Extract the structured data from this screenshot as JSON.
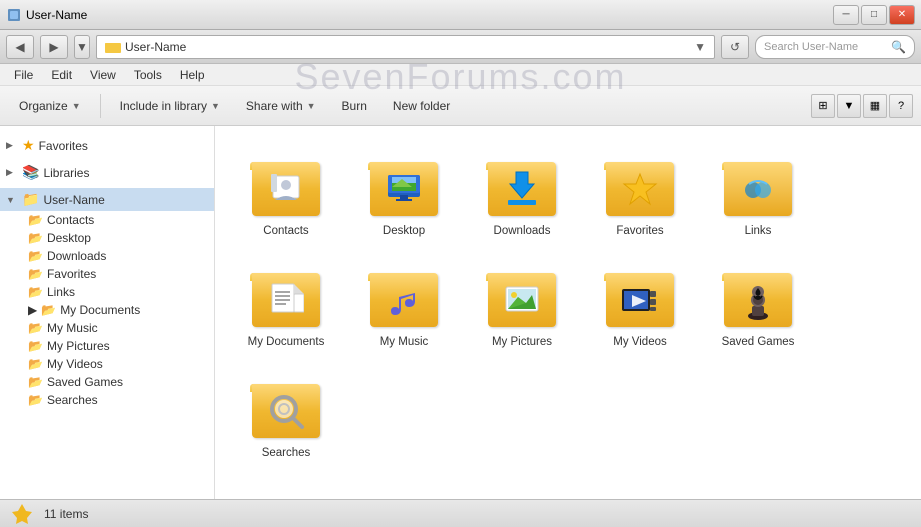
{
  "titlebar": {
    "title": "User-Name",
    "controls": {
      "minimize": "─",
      "maximize": "□",
      "close": "✕"
    }
  },
  "addressbar": {
    "back": "◀",
    "forward": "▶",
    "path": "User-Name",
    "search_placeholder": "Search User-Name"
  },
  "menubar": {
    "items": [
      "File",
      "Edit",
      "View",
      "Tools",
      "Help"
    ]
  },
  "toolbar": {
    "organize": "Organize",
    "include_library": "Include in library",
    "share_with": "Share with",
    "burn": "Burn",
    "new_folder": "New folder",
    "help": "?"
  },
  "sidebar": {
    "favorites_label": "Favorites",
    "libraries_label": "Libraries",
    "username_label": "User-Name",
    "items": [
      {
        "label": "Contacts",
        "selected": false
      },
      {
        "label": "Desktop",
        "selected": false
      },
      {
        "label": "Downloads",
        "selected": false
      },
      {
        "label": "Favorites",
        "selected": false
      },
      {
        "label": "Links",
        "selected": false
      },
      {
        "label": "My Documents",
        "selected": false
      },
      {
        "label": "My Music",
        "selected": false
      },
      {
        "label": "My Pictures",
        "selected": false
      },
      {
        "label": "My Videos",
        "selected": false
      },
      {
        "label": "Saved Games",
        "selected": false
      },
      {
        "label": "Searches",
        "selected": false
      }
    ]
  },
  "files": [
    {
      "name": "Contacts",
      "type": "contacts"
    },
    {
      "name": "Desktop",
      "type": "desktop"
    },
    {
      "name": "Downloads",
      "type": "downloads"
    },
    {
      "name": "Favorites",
      "type": "favorites"
    },
    {
      "name": "Links",
      "type": "links"
    },
    {
      "name": "My Documents",
      "type": "documents"
    },
    {
      "name": "My Music",
      "type": "music"
    },
    {
      "name": "My Pictures",
      "type": "pictures"
    },
    {
      "name": "My Videos",
      "type": "videos"
    },
    {
      "name": "Saved Games",
      "type": "savedgames"
    },
    {
      "name": "Searches",
      "type": "searches"
    }
  ],
  "statusbar": {
    "count": "11 items"
  },
  "watermark": "SevenForums.com"
}
